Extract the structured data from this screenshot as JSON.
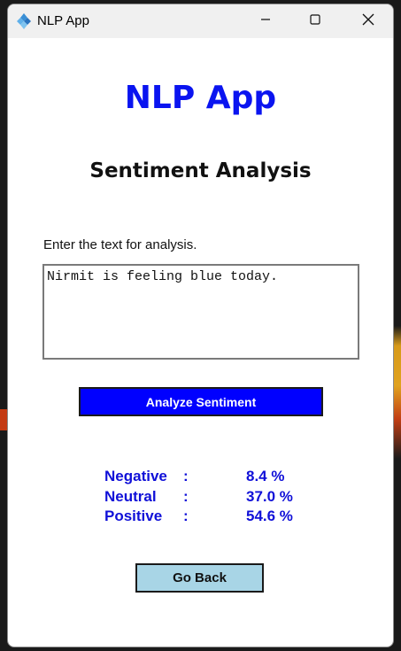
{
  "window": {
    "title": "NLP App",
    "icon": "tkinter-feather-icon",
    "controls": [
      "minimize-icon",
      "maximize-icon",
      "close-icon"
    ]
  },
  "app": {
    "title": "NLP App",
    "subtitle": "Sentiment Analysis"
  },
  "input": {
    "label": "Enter the text for analysis.",
    "value": "Nirmit is feeling blue today."
  },
  "analyze_button": {
    "label": "Analyze Sentiment"
  },
  "results": [
    {
      "label": "Negative",
      "colon": ":",
      "value": "8.4 %"
    },
    {
      "label": "Neutral",
      "colon": ":",
      "value": "37.0 %"
    },
    {
      "label": "Positive",
      "colon": ":",
      "value": "54.6 %"
    }
  ],
  "back_button": {
    "label": "Go Back"
  },
  "colors": {
    "title": "#0a14f0",
    "analyze_button_bg": "#0000ff",
    "back_button_bg": "#a8d5e6",
    "results_text": "#1010d8"
  }
}
